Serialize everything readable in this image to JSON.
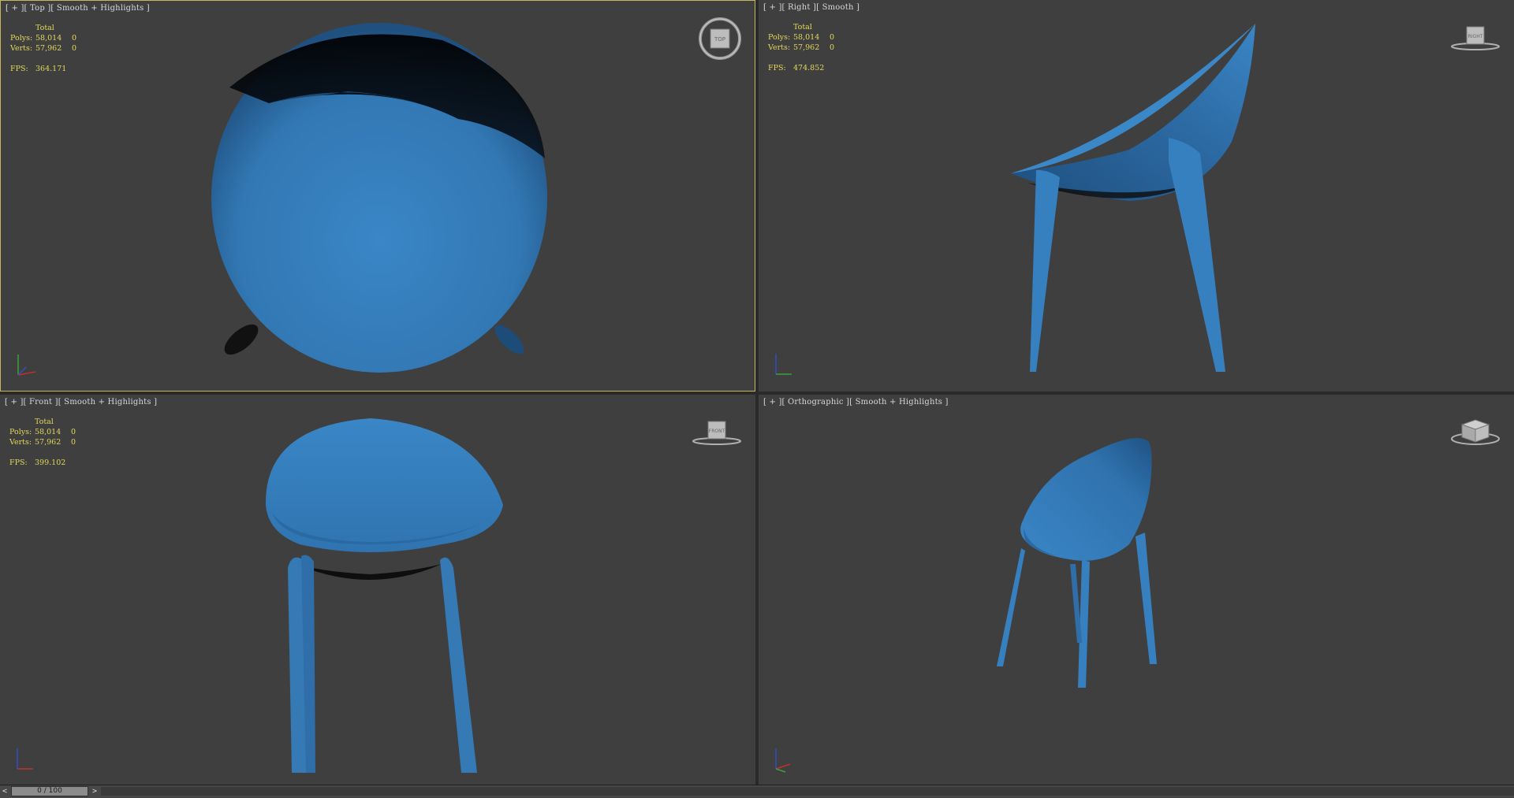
{
  "viewports": {
    "top": {
      "label": "[ + ][ Top ][ Smooth + Highlights ]",
      "stats": {
        "total": "Total",
        "polys_label": "Polys:",
        "polys_value": "58,014",
        "polys_sel": "0",
        "verts_label": "Verts:",
        "verts_value": "57,962",
        "verts_sel": "0",
        "fps_label": "FPS:",
        "fps_value": "364.171"
      },
      "navcube_label": "TOP",
      "active": true
    },
    "right": {
      "label": "[ + ][ Right ][ Smooth ]",
      "stats": {
        "total": "Total",
        "polys_label": "Polys:",
        "polys_value": "58,014",
        "polys_sel": "0",
        "verts_label": "Verts:",
        "verts_value": "57,962",
        "verts_sel": "0",
        "fps_label": "FPS:",
        "fps_value": "474.852"
      },
      "navcube_label": "RIGHT"
    },
    "front": {
      "label": "[ + ][ Front ][ Smooth + Highlights ]",
      "stats": {
        "total": "Total",
        "polys_label": "Polys:",
        "polys_value": "58,014",
        "polys_sel": "0",
        "verts_label": "Verts:",
        "verts_value": "57,962",
        "verts_sel": "0",
        "fps_label": "FPS:",
        "fps_value": "399.102"
      },
      "navcube_label": "FRONT"
    },
    "ortho": {
      "label": "[ + ][ Orthographic ][ Smooth + Highlights ]",
      "navcube_label": ""
    }
  },
  "timeline": {
    "prev": "<",
    "frame": "0 / 100",
    "next": ">"
  },
  "colors": {
    "chair": "#3a84c4",
    "viewport_bg": "#3f3f3f",
    "active_border": "#c8b560",
    "stats_text": "#e4d85a"
  }
}
